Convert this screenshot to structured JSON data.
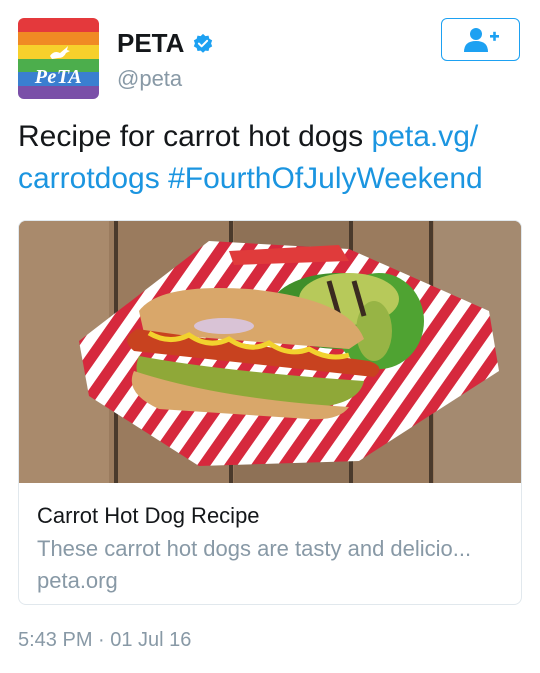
{
  "account": {
    "display_name": "PETA",
    "handle": "@peta",
    "avatar_text": "PeTA",
    "verified_icon": "verified-badge-icon"
  },
  "follow_button": {
    "icon": "add-user-icon"
  },
  "tweet": {
    "text": "Recipe for carrot hot dogs ",
    "link1": "peta.vg/",
    "link2": "carrotdogs",
    "hashtag": "#FourthOfJulyWeekend"
  },
  "card": {
    "title": "Carrot Hot Dog Recipe",
    "description": "These carrot hot dogs are tasty and delicio...",
    "domain": "peta.org"
  },
  "timestamp": "5:43 PM · 01 Jul 16",
  "colors": {
    "link": "#1b95e0",
    "muted": "#8899a6",
    "rainbow": [
      "#e4393c",
      "#f08a24",
      "#f7d02c",
      "#4cae4c",
      "#3a7fd0",
      "#7a4fa8"
    ]
  }
}
